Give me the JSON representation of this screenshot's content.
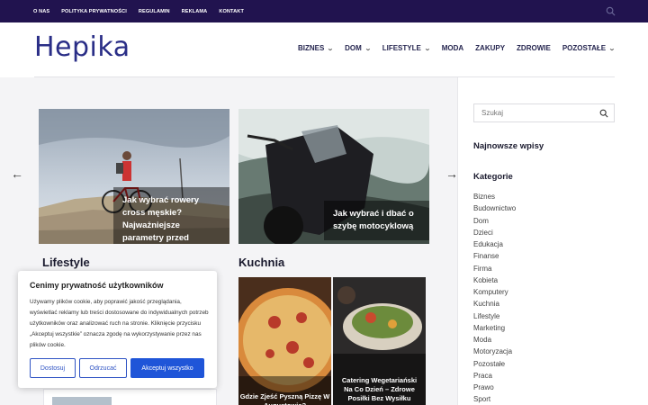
{
  "topbar": {
    "links": [
      "O NAS",
      "POLITYKA PRYWATNOŚCI",
      "REGULAMIN",
      "REKLAMA",
      "KONTAKT"
    ]
  },
  "header": {
    "logo": "Hepika",
    "nav": [
      {
        "label": "BIZNES",
        "dropdown": true
      },
      {
        "label": "DOM",
        "dropdown": true
      },
      {
        "label": "LIFESTYLE",
        "dropdown": true
      },
      {
        "label": "MODA",
        "dropdown": false
      },
      {
        "label": "ZAKUPY",
        "dropdown": false
      },
      {
        "label": "ZDROWIE",
        "dropdown": false
      },
      {
        "label": "POZOSTAŁE",
        "dropdown": true
      }
    ]
  },
  "slider": {
    "cards": [
      {
        "caption": "Jak wybrać rowery cross męskie? Najważniejsze parametry przed zakupem"
      },
      {
        "caption": "Jak wybrać i dbać o szybę motocyklową"
      }
    ]
  },
  "sections": {
    "lifestyle": "Lifestyle",
    "kuchnia": "Kuchnia"
  },
  "kuchnia_posts": [
    {
      "title": "Gdzie Zjeść Pyszną Pizzę W Augustowie?"
    },
    {
      "title": "Catering Wegetariański Na Co Dzień – Zdrowe Posiłki Bez Wysiłku"
    }
  ],
  "cookie": {
    "title": "Cenimy prywatność użytkowników",
    "text": "Używamy plików cookie, aby poprawić jakość przeglądania, wyświetlać reklamy lub treści dostosowane do indywidualnych potrzeb użytkowników oraz analizować ruch na stronie. Kliknięcie przycisku „Akceptuj wszystkie” oznacza zgodę na wykorzystywanie przez nas plików cookie.",
    "customize": "Dostosuj",
    "reject": "Odrzucać",
    "accept": "Akceptuj wszystko"
  },
  "sidebar": {
    "search_placeholder": "Szukaj",
    "latest_heading": "Najnowsze wpisy",
    "categories_heading": "Kategorie",
    "categories": [
      "Biznes",
      "Budownictwo",
      "Dom",
      "Dzieci",
      "Edukacja",
      "Finanse",
      "Firma",
      "Kobieta",
      "Komputery",
      "Kuchnia",
      "Lifestyle",
      "Marketing",
      "Moda",
      "Motoryzacja",
      "Pozostałe",
      "Praca",
      "Prawo",
      "Sport"
    ]
  },
  "colors": {
    "topbar": "#21134f",
    "logo": "#2a2e87",
    "accent_button": "#1f55d8"
  }
}
